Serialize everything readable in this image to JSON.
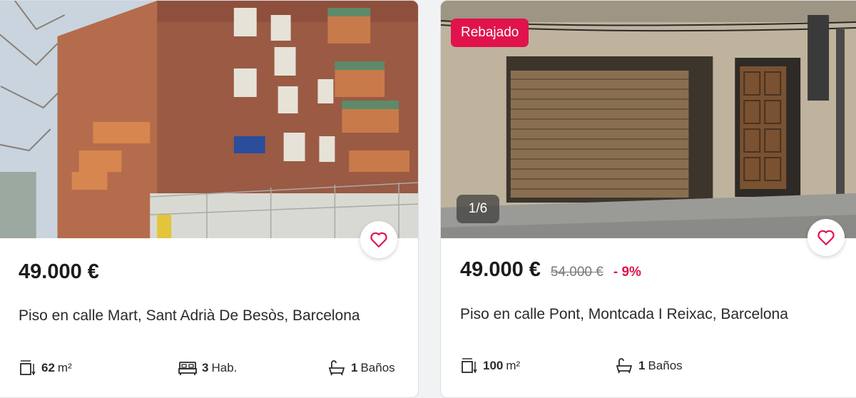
{
  "listings": [
    {
      "price": "49.000 €",
      "title": "Piso en calle Mart, Sant Adrià De Besòs, Barcelona",
      "features": {
        "area_value": "62",
        "area_unit": "m²",
        "rooms_value": "3",
        "rooms_unit": "Hab.",
        "baths_value": "1",
        "baths_unit": "Baños"
      },
      "favorite_icon": "heart-icon"
    },
    {
      "badge": "Rebajado",
      "photo_counter": "1/6",
      "price": "49.000 €",
      "old_price": "54.000 €",
      "discount": "- 9%",
      "title": "Piso en calle Pont, Montcada I Reixac, Barcelona",
      "features": {
        "area_value": "100",
        "area_unit": "m²",
        "baths_value": "1",
        "baths_unit": "Baños"
      },
      "favorite_icon": "heart-icon"
    }
  ],
  "colors": {
    "accent": "#e1134d",
    "text": "#1c1c1e",
    "card_border": "#dcdde0"
  }
}
